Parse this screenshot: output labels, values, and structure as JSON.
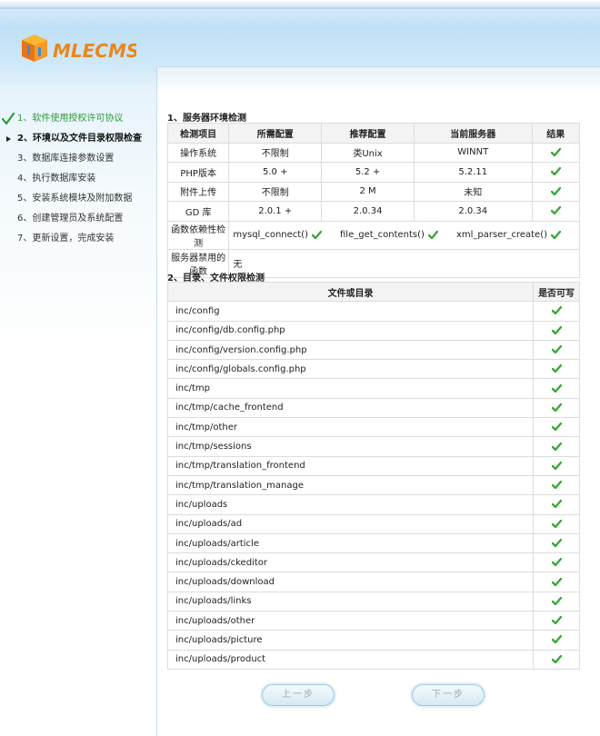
{
  "brand": {
    "logo_text": "MLECMS"
  },
  "steps": [
    {
      "label": "1、软件使用授权许可协议",
      "state": "done"
    },
    {
      "label": "2、环境以及文件目录权限检查",
      "state": "current"
    },
    {
      "label": "3、数据库连接参数设置",
      "state": "pending"
    },
    {
      "label": "4、执行数据库安装",
      "state": "pending"
    },
    {
      "label": "5、安装系统模块及附加数据",
      "state": "pending"
    },
    {
      "label": "6、创建管理员及系统配置",
      "state": "pending"
    },
    {
      "label": "7、更新设置，完成安装",
      "state": "pending"
    }
  ],
  "env": {
    "title": "1、服务器环境检测",
    "headers": [
      "检测项目",
      "所需配置",
      "推荐配置",
      "当前服务器",
      "结果"
    ],
    "rows": [
      {
        "item": "操作系统",
        "required": "不限制",
        "recommended": "类Unix",
        "current": "WINNT"
      },
      {
        "item": "PHP版本",
        "required": "5.0 +",
        "recommended": "5.2 +",
        "current": "5.2.11"
      },
      {
        "item": "附件上传",
        "required": "不限制",
        "recommended": "2 M",
        "current": "未知"
      },
      {
        "item": "GD 库",
        "required": "2.0.1 +",
        "recommended": "2.0.34",
        "current": "2.0.34"
      }
    ],
    "func_label": "函数依赖性检测",
    "funcs": [
      "mysql_connect()",
      "file_get_contents()",
      "xml_parser_create()"
    ],
    "disabled_label": "服务器禁用的函数",
    "disabled_value": "无"
  },
  "perm": {
    "title": "2、目录、文件权限检测",
    "headers": [
      "文件或目录",
      "是否可写"
    ],
    "rows": [
      "inc/config",
      "inc/config/db.config.php",
      "inc/config/version.config.php",
      "inc/config/globals.config.php",
      "inc/tmp",
      "inc/tmp/cache_frontend",
      "inc/tmp/other",
      "inc/tmp/sessions",
      "inc/tmp/translation_frontend",
      "inc/tmp/translation_manage",
      "inc/uploads",
      "inc/uploads/ad",
      "inc/uploads/article",
      "inc/uploads/ckeditor",
      "inc/uploads/download",
      "inc/uploads/links",
      "inc/uploads/other",
      "inc/uploads/picture",
      "inc/uploads/product"
    ]
  },
  "buttons": {
    "prev": "上一步",
    "next": "下一步"
  },
  "colors": {
    "check": "#3aa83a",
    "accent": "#2b9b3a"
  }
}
